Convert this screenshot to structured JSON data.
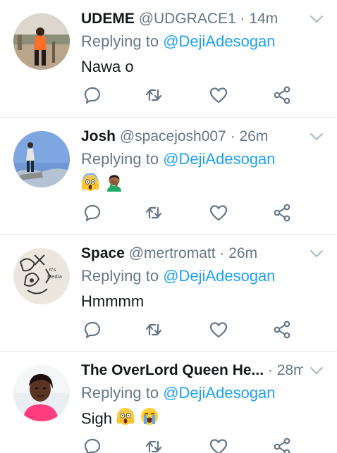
{
  "tweets": [
    {
      "name": "UDEME",
      "handle": "@UDGRACE1",
      "separator": "·",
      "time": "14m",
      "replying_prefix": "Replying to",
      "replying_to": "@DejiAdesogan",
      "text": "Nawa o",
      "emojis": []
    },
    {
      "name": "Josh",
      "handle": "@spacejosh007",
      "separator": "·",
      "time": "26m",
      "replying_prefix": "Replying to",
      "replying_to": "@DejiAdesogan",
      "text": "",
      "emojis": [
        "face-screaming-in-fear",
        "man-facepalming"
      ]
    },
    {
      "name": "Space",
      "handle": "@mertromatt",
      "separator": "·",
      "time": "26m",
      "replying_prefix": "Replying to",
      "replying_to": "@DejiAdesogan",
      "text": "Hmmmm",
      "emojis": [],
      "avatar_text": [
        "It's",
        "Media"
      ]
    },
    {
      "name": "The OverLord Queen He...",
      "handle": "",
      "separator": "·",
      "time": "28m",
      "replying_prefix": "Replying to",
      "replying_to": "@DejiAdesogan",
      "text": "Sigh",
      "emojis": [
        "face-screaming-in-fear",
        "loudly-crying-face"
      ]
    }
  ],
  "colors": {
    "link": "#1da1f2",
    "secondary_text": "#657786",
    "primary_text": "#14171a",
    "divider": "#e1e8ed"
  },
  "icons": {
    "reply": "comment-bubble-icon",
    "retweet": "retweet-arrows-icon",
    "like": "heart-outline-icon",
    "share": "share-nodes-icon",
    "menu": "chevron-down-icon"
  }
}
